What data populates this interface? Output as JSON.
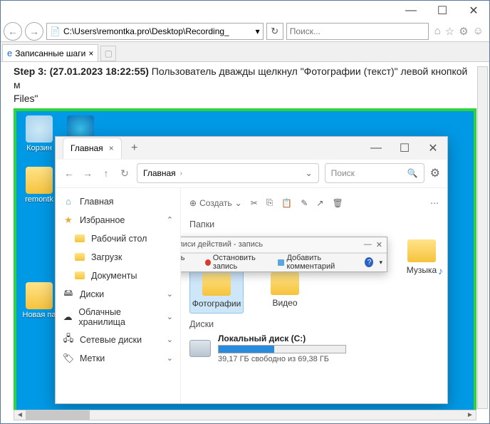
{
  "window": {
    "min": "—",
    "max": "☐",
    "close": "✕"
  },
  "ie": {
    "address": "C:\\Users\\remontka.pro\\Desktop\\Recording_",
    "search_placeholder": "Поиск...",
    "tab_title": "Записанные шаги",
    "icons": {
      "home": "⌂",
      "star": "☆",
      "gear": "⚙",
      "smile": "☺"
    }
  },
  "step": {
    "label": "Step 3:",
    "timestamp": "(27.01.2023 18:22:55)",
    "text": "Пользователь дважды щелкнул \"Фотографии (текст)\" левой кнопкой м",
    "line2": "Files\""
  },
  "desktop": {
    "recycle": "Корзин",
    "remontka": "remontk",
    "novaya": "Новая па"
  },
  "explorer": {
    "tab": "Главная",
    "crumb": "Главная",
    "search": "Поиск",
    "create": "Создать",
    "side": {
      "home": "Главная",
      "fav": "Избранное",
      "desktop": "Рабочий стол",
      "downloads": "Загрузк",
      "documents": "Документы",
      "drives": "Диски",
      "cloud": "Облачные хранилища",
      "network": "Сетевые диски",
      "tags": "Метки"
    },
    "sections": {
      "folders": "Папки",
      "drives": "Диски"
    },
    "folders": {
      "photos": "Фотографии",
      "video": "Видео",
      "music": "Музыка"
    },
    "disk": {
      "name": "Локальный диск (C:)",
      "free": "39,17 ГБ свободно из 69,38 ГБ"
    }
  },
  "psr": {
    "title": "Средство записи действий - запись",
    "pause": "Приостановить запись",
    "stop": "Остановить запись",
    "comment": "Добавить комментарий"
  }
}
